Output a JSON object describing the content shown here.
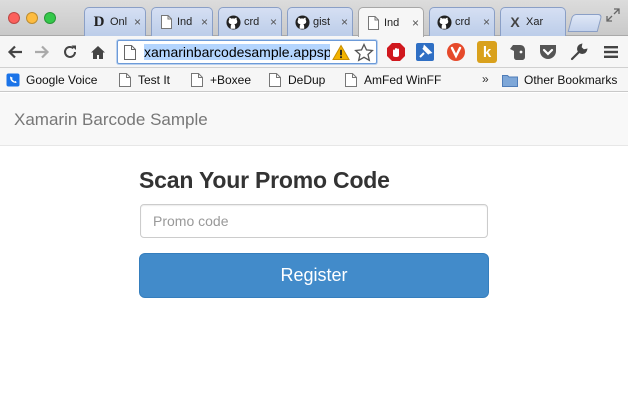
{
  "browser": {
    "tabs": [
      {
        "title": "Onl",
        "icon": "d-letter-icon",
        "active": false
      },
      {
        "title": "Ind",
        "icon": "page-icon",
        "active": false
      },
      {
        "title": "crd",
        "icon": "github-icon",
        "active": false
      },
      {
        "title": "gist",
        "icon": "github-icon",
        "active": false
      },
      {
        "title": "Ind",
        "icon": "page-icon",
        "active": true
      },
      {
        "title": "crd",
        "icon": "github-icon",
        "active": false
      },
      {
        "title": "Xar",
        "icon": "x-letter-icon",
        "active": false
      }
    ],
    "tab_close_glyph": "×",
    "d_glyph": "D",
    "x_glyph": "X",
    "address": {
      "value": "xamarinbarcodesample.appspot.com"
    },
    "bookmarks": [
      {
        "label": "Google Voice",
        "icon": "google-voice-icon"
      },
      {
        "label": "Test It",
        "icon": "page-icon"
      },
      {
        "label": "+Boxee",
        "icon": "page-icon"
      },
      {
        "label": "DeDup",
        "icon": "page-icon"
      },
      {
        "label": "AmFed WinFF",
        "icon": "page-icon"
      }
    ],
    "bookmarks_overflow": "»",
    "other_bookmarks": "Other Bookmarks",
    "extension_k_glyph": "k"
  },
  "site": {
    "brand": "Xamarin Barcode Sample",
    "heading": "Scan Your Promo Code",
    "promo_placeholder": "Promo code",
    "register_label": "Register"
  },
  "colors": {
    "primary_button": "#428bca",
    "brand_text": "#777777",
    "tab_inactive": "#c6d4ee"
  }
}
